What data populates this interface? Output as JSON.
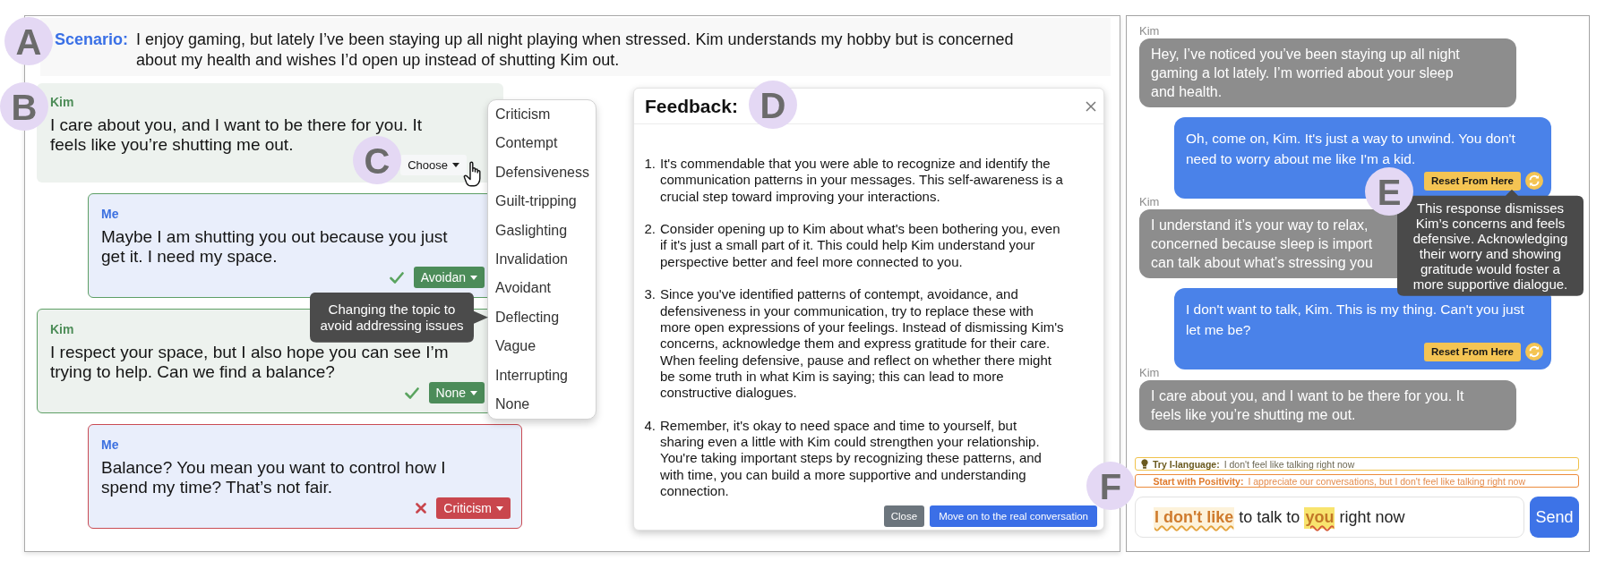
{
  "scenario": {
    "marker": "A",
    "label": "Scenario:",
    "lines": [
      "I enjoy gaming, but lately I’ve been staying up all night playing when stressed. Kim understands my hobby but is concerned",
      "about my health and wishes I’d open up instead of shutting Kim out."
    ]
  },
  "practice": {
    "messages": [
      {
        "kind": "partner",
        "marker": "B",
        "speaker": "Kim",
        "lines": [
          "I care about you, and I want to be there for you. It",
          "feels like you’re shutting me out."
        ],
        "correct": false,
        "wrong": false,
        "tag": {
          "label": "Choose",
          "marker": "C",
          "open": true,
          "menu": [
            {
              "label": "Criticism",
              "selected": false
            },
            {
              "label": "Contempt",
              "selected": false
            },
            {
              "label": "Defensiveness",
              "selected": false
            },
            {
              "label": "Guilt-tripping",
              "selected": false
            },
            {
              "label": "Gaslighting",
              "selected": false
            },
            {
              "label": "Invalidation",
              "selected": false
            },
            {
              "label": "Avoidant",
              "selected": false
            },
            {
              "label": "Deflecting",
              "selected": false,
              "tooltip_lines": [
                "Changing the topic to",
                "avoid addressing issues"
              ]
            },
            {
              "label": "Vague",
              "selected": false
            },
            {
              "label": "Interrupting",
              "selected": false
            },
            {
              "label": "None",
              "selected": false
            }
          ]
        }
      },
      {
        "kind": "user",
        "speaker": "Me",
        "lines": [
          "Maybe I am shutting you out because you just",
          "get it. I need my space."
        ],
        "correct": true,
        "wrong": false,
        "tag": {
          "label": "Avoidan"
        }
      },
      {
        "kind": "partner",
        "speaker": "Kim",
        "lines": [
          "I respect your space, but I also hope you can see I’m",
          "trying to help. Can we find a balance?"
        ],
        "correct": true,
        "wrong": false,
        "tag": {
          "label": "None"
        }
      },
      {
        "kind": "user",
        "speaker": "Me",
        "lines": [
          "Balance? You mean you want to control how I",
          "spend my time? That’s not fair."
        ],
        "correct": false,
        "wrong": true,
        "tag": {
          "label": "Criticism"
        }
      }
    ]
  },
  "feedback": {
    "marker": "D",
    "title": "Feedback:",
    "items": [
      {
        "number": "1.",
        "lines": [
          "It's commendable that you were able to recognize and identify the",
          "communication patterns in your messages. This self-awareness is a",
          "crucial step toward improving your interactions."
        ]
      },
      {
        "number": "2.",
        "lines": [
          "Consider opening up to Kim about what's been bothering you, even",
          "if it's just a small part of it. This could help Kim understand your",
          "perspective better and feel more connected to you."
        ]
      },
      {
        "number": "3.",
        "lines": [
          "Since you've identified patterns of contempt, avoidance, and",
          "defensiveness in your communication, try to replace these with",
          "more open expressions of your feelings. Instead of dismissing Kim's",
          "concerns, acknowledge them and express gratitude for their care.",
          "When feeling defensive, pause and reflect on whether there might",
          "be some truth in what Kim is saying; this can lead to more",
          "constructive dialogues."
        ]
      },
      {
        "number": "4.",
        "lines": [
          "Remember, it's okay to need space and time to yourself, but",
          "sharing even a little with Kim could strengthen your relationship.",
          "You're taking important steps by recognizing these patterns, and",
          "with time, you can build a more supportive and understanding",
          "connection."
        ]
      }
    ],
    "buttons": [
      {
        "label": "Close",
        "kind": "secondary"
      },
      {
        "label": "Move on to the real conversation",
        "kind": "primary"
      }
    ]
  },
  "chat": {
    "messages": [
      {
        "kind": "partner",
        "speaker": "Kim",
        "lines": [
          "Hey, I’ve noticed you’ve been staying up all night",
          "gaming a lot lately. I’m worried about your sleep",
          "and health."
        ]
      },
      {
        "kind": "user",
        "marker": "E",
        "lines": [
          "Oh, come on, Kim. It's just a way to unwind. You don't",
          "need to worry about me like I'm a kid."
        ],
        "reset_label": "Reset From Here",
        "tooltip_lines": [
          "This response dismisses",
          "Kim’s concerns and feels",
          "defensive. Acknowledging",
          "their worry and showing",
          "gratitude would foster a",
          "more supportive dialogue."
        ]
      },
      {
        "kind": "partner",
        "speaker": "Kim",
        "lines": [
          "I understand it’s your way to relax,",
          "concerned because sleep is import",
          "can talk about what’s stressing you"
        ]
      },
      {
        "kind": "user",
        "lines": [
          "I don't want to talk, Kim. This is my thing. Can't you just",
          "let me be?"
        ],
        "reset_label": "Reset From Here"
      },
      {
        "kind": "partner",
        "speaker": "Kim",
        "lines": [
          "I care about you, and I want to be there for you. It",
          "feels like you’re shutting me out."
        ]
      }
    ]
  },
  "composer": {
    "marker": "F",
    "suggestions": [
      {
        "kind": "i-language",
        "color": "#f0c24b",
        "label": "Try I-language:",
        "text": "I don't feel like talking right now"
      },
      {
        "kind": "positivity",
        "color": "#ec8b3c",
        "label": "Start with Positivity:",
        "text": "I appreciate our conversations, but I don't feel like talking right now"
      }
    ],
    "segments": [
      {
        "text": "I don't like",
        "kind": "positivity"
      },
      {
        "text": "to talk to",
        "kind": "plain"
      },
      {
        "text": "you",
        "kind": "i-language"
      },
      {
        "text": "right now",
        "kind": "plain"
      }
    ],
    "send_label": "Send"
  }
}
